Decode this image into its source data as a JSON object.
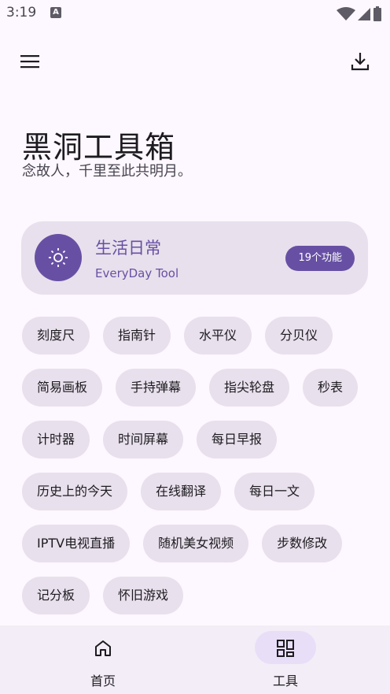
{
  "status_bar": {
    "time": "3:19",
    "a_icon": "A"
  },
  "top_bar": {
    "menu_icon": "menu-icon",
    "download_icon": "download-icon"
  },
  "hero": {
    "title": "黑洞工具箱",
    "subtitle": "念故人，千里至此共明月。"
  },
  "category": {
    "title": "生活日常",
    "subtitle": "EveryDay Tool",
    "badge": "19个功能",
    "icon": "sun-icon",
    "accent_color": "#6750a4"
  },
  "tools": [
    [
      "刻度尺",
      "指南针",
      "水平仪",
      "分贝仪"
    ],
    [
      "简易画板",
      "手持弹幕",
      "指尖轮盘",
      "秒表"
    ],
    [
      "计时器",
      "时间屏幕",
      "每日早报"
    ],
    [
      "历史上的今天",
      "在线翻译",
      "每日一文"
    ],
    [
      "IPTV电视直播",
      "随机美女视频",
      "步数修改"
    ],
    [
      "记分板",
      "怀旧游戏"
    ]
  ],
  "bottom_nav": {
    "home_label": "首页",
    "tools_label": "工具",
    "active": "tools"
  }
}
